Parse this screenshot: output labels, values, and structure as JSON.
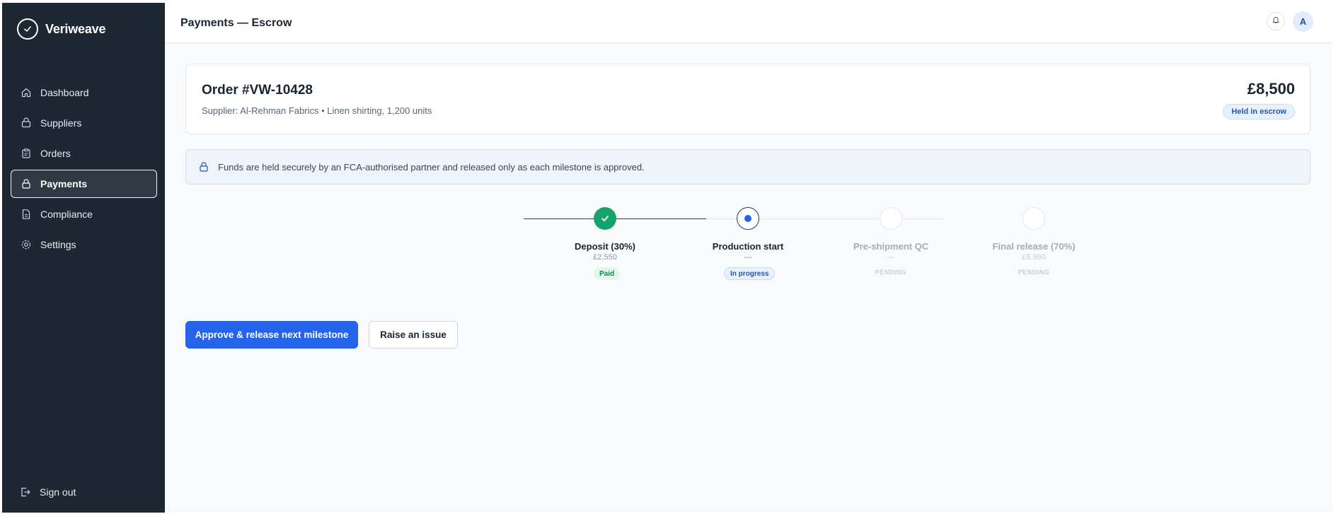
{
  "brand": {
    "name": "Veriweave"
  },
  "sidebar": {
    "items": [
      {
        "label": "Dashboard",
        "icon": "home-icon"
      },
      {
        "label": "Suppliers",
        "icon": "building-icon"
      },
      {
        "label": "Orders",
        "icon": "clipboard-icon"
      },
      {
        "label": "Payments",
        "icon": "lock-icon",
        "active": true
      },
      {
        "label": "Compliance",
        "icon": "document-icon"
      },
      {
        "label": "Settings",
        "icon": "gear-icon"
      }
    ],
    "signout_label": "Sign out"
  },
  "header": {
    "title": "Payments — Escrow",
    "avatar_initial": "A"
  },
  "order": {
    "title": "Order #VW-10428",
    "subtitle": "Supplier: Al-Rehman Fabrics • Linen shirting, 1,200 units",
    "amount": "£8,500",
    "badge": "Held in escrow"
  },
  "notice": {
    "text": "Funds are held securely by an FCA-authorised partner and released only as each milestone is approved."
  },
  "milestones": [
    {
      "label": "Deposit (30%)",
      "amount": "£2,550",
      "status": "Paid",
      "state": "done"
    },
    {
      "label": "Production start",
      "amount": "—",
      "status": "In progress",
      "state": "current"
    },
    {
      "label": "Pre-shipment QC",
      "amount": "—",
      "status": "PENDING",
      "state": "pending"
    },
    {
      "label": "Final release (70%)",
      "amount": "£5,950",
      "status": "PENDING",
      "state": "pending"
    }
  ],
  "actions": {
    "primary": "Approve & release next milestone",
    "secondary": "Raise an issue"
  },
  "colors": {
    "sidebar": "#1d2833",
    "accent": "#2563eb",
    "success": "#16a36a"
  }
}
